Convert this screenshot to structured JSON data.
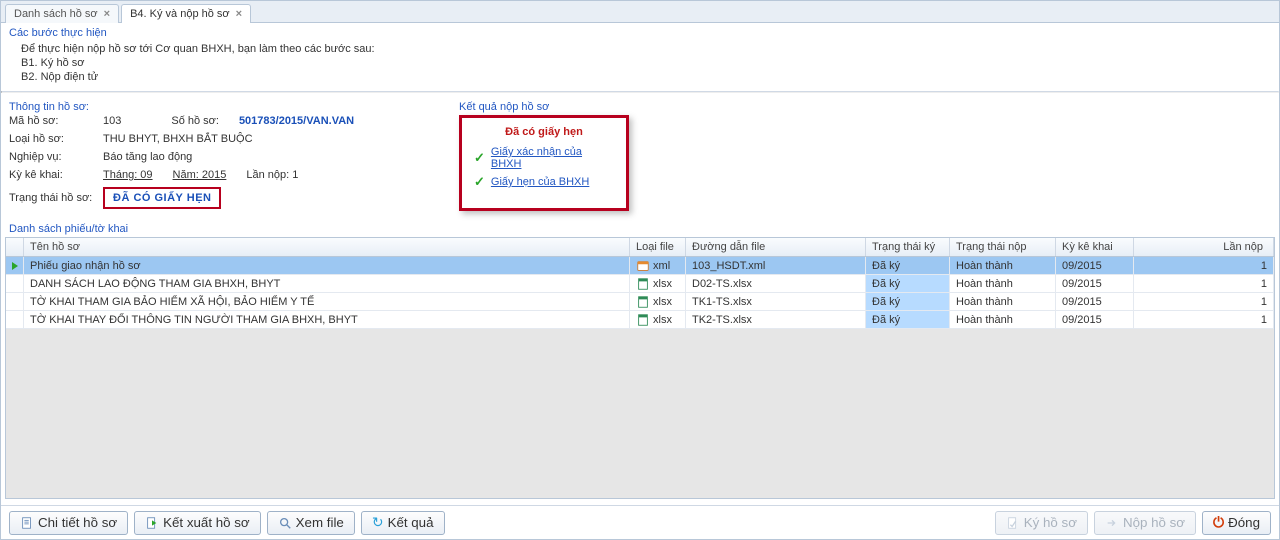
{
  "tabs": [
    {
      "label": "Danh sách hồ sơ",
      "active": false
    },
    {
      "label": "B4. Ký và nộp hồ sơ",
      "active": true
    }
  ],
  "steps": {
    "title": "Các bước thực hiện",
    "intro": "Để thực hiện nộp hồ sơ tới Cơ quan BHXH, bạn làm theo các bước sau:",
    "b1": "B1. Ký hồ sơ",
    "b2": "B2. Nộp điện tử"
  },
  "info": {
    "title": "Thông tin hồ sơ:",
    "ma_label": "Mã hồ sơ:",
    "ma_value": "103",
    "so_label": "Số hồ sơ:",
    "so_value": "501783/2015/VAN.VAN",
    "loai_label": "Loại hồ sơ:",
    "loai_value": "THU BHYT, BHXH BẮT BUỘC",
    "nghiepvu_label": "Nghiệp vụ:",
    "nghiepvu_value": "Báo tăng lao động",
    "ky_label": "Kỳ kê khai:",
    "thang_label": "Tháng: 09",
    "nam_label": "Năm: 2015",
    "lannop_label": "Lần nộp: 1",
    "trangthai_label": "Trạng thái hồ sơ:",
    "trangthai_value": "ĐÃ CÓ GIẤY HẸN"
  },
  "result": {
    "title": "Kết quả nộp hồ sơ",
    "heading": "Đã có giấy hẹn",
    "link1": "Giấy xác nhận của BHXH",
    "link2": "Giấy hẹn của BHXH"
  },
  "list": {
    "title": "Danh sách phiếu/tờ khai",
    "headers": {
      "ten": "Tên hồ sơ",
      "loai": "Loại file",
      "duongdan": "Đường dẫn file",
      "ttky": "Trạng thái ký",
      "ttnop": "Trạng thái nộp",
      "ky": "Kỳ kê khai",
      "lannop": "Lần nộp"
    },
    "rows": [
      {
        "ten": "Phiếu giao nhận hồ sơ",
        "loai": "xml",
        "duongdan": "103_HSDT.xml",
        "ttky": "Đã ký",
        "ttnop": "Hoàn thành",
        "ky": "09/2015",
        "lannop": "1",
        "sel": true,
        "icon": "xml"
      },
      {
        "ten": "DANH SÁCH LAO ĐỘNG THAM GIA BHXH, BHYT",
        "loai": "xlsx",
        "duongdan": "D02-TS.xlsx",
        "ttky": "Đã ký",
        "ttnop": "Hoàn thành",
        "ky": "09/2015",
        "lannop": "1",
        "icon": "xlsx"
      },
      {
        "ten": "TỜ KHAI THAM GIA BẢO HIỂM XÃ HỘI, BẢO HIỂM Y TẾ",
        "loai": "xlsx",
        "duongdan": "TK1-TS.xlsx",
        "ttky": "Đã ký",
        "ttnop": "Hoàn thành",
        "ky": "09/2015",
        "lannop": "1",
        "icon": "xlsx"
      },
      {
        "ten": "TỜ KHAI THAY ĐỔI THÔNG TIN NGƯỜI THAM GIA BHXH, BHYT",
        "loai": "xlsx",
        "duongdan": "TK2-TS.xlsx",
        "ttky": "Đã ký",
        "ttnop": "Hoàn thành",
        "ky": "09/2015",
        "lannop": "1",
        "icon": "xlsx"
      }
    ]
  },
  "footer": {
    "chitiet": "Chi tiết hồ sơ",
    "ketxuat": "Kết xuất hồ sơ",
    "xemfile": "Xem file",
    "ketqua": "Kết quả",
    "kyhoso": "Ký hồ sơ",
    "nophoso": "Nộp hồ sơ",
    "dong": "Đóng"
  }
}
